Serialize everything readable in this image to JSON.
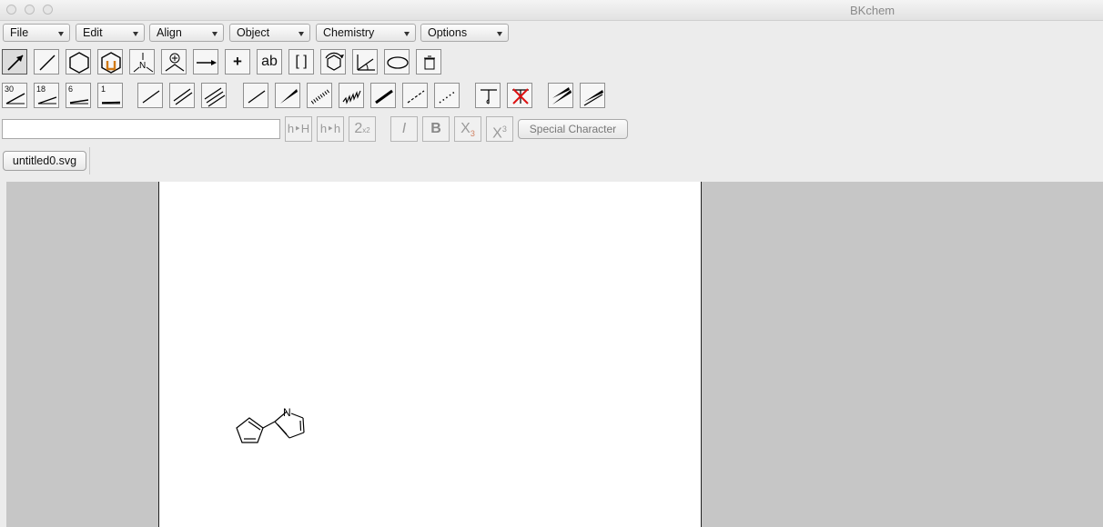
{
  "window": {
    "title": "BKchem"
  },
  "menus": [
    {
      "label": "File"
    },
    {
      "label": "Edit"
    },
    {
      "label": "Align"
    },
    {
      "label": "Object"
    },
    {
      "label": "Chemistry"
    },
    {
      "label": "Options"
    }
  ],
  "mode_tools": {
    "text_tool_label": "ab",
    "bracket_tool_label": "[ ]",
    "plus_tool_label": "+"
  },
  "angle_tools": [
    "30",
    "18",
    "6",
    "1"
  ],
  "format_bar": {
    "text_input_value": "",
    "subscript_digit": "2",
    "subscript_tool_sub": "x2",
    "hh_label_1": "h‣H",
    "hh_label_2": "h‣h",
    "italic_label": "I",
    "bold_label": "B",
    "sub_label": "X",
    "sub_index": "3",
    "sup_label": "X",
    "sup_index": "3",
    "special_character_label": "Special Character"
  },
  "tabs": [
    {
      "label": "untitled0.svg",
      "active": true
    }
  ],
  "drawing": {
    "heteroatom_label": "N"
  }
}
